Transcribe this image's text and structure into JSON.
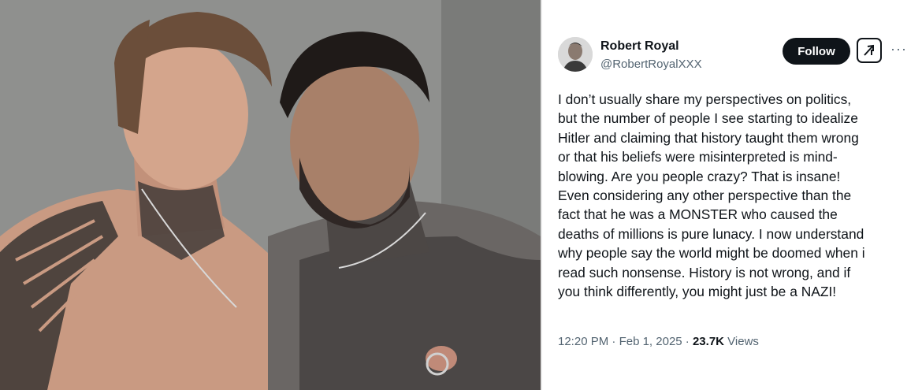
{
  "tweet": {
    "author_name": "Robert Royal",
    "author_handle": "@RobertRoyalXXX",
    "follow_label": "Follow",
    "more_label": "···",
    "text_lines": [
      "I don’t usually share my perspectives on politics,",
      "but the number of people I see starting to idealize",
      "Hitler and claiming that history taught them wrong",
      "or that his beliefs were misinterpreted is mind-",
      "blowing. Are you people crazy? That is insane!",
      "Even considering any other perspective than the",
      "fact that he was a MONSTER who caused the",
      "deaths of millions is pure lunacy. I now understand",
      "why people say the world might be doomed when i",
      "read such nonsense. History is not wrong, and if",
      "you think differently, you might just be a NAZI!"
    ],
    "time": "12:20 PM",
    "date": "Feb 1, 2025",
    "separator": "·",
    "views_count": "23.7K",
    "views_label": "Views"
  },
  "icons": {
    "grok": "grok-icon",
    "more": "more-options-icon"
  },
  "colors": {
    "follow_bg": "#0f1419",
    "secondary_text": "#536471",
    "primary_text": "#0f1419"
  }
}
